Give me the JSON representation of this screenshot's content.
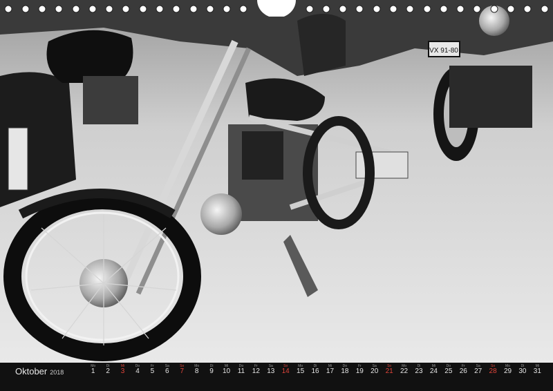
{
  "calendar": {
    "month": "Oktober",
    "year": "2018",
    "days": [
      {
        "n": "1",
        "wd": "Mo",
        "red": false
      },
      {
        "n": "2",
        "wd": "Di",
        "red": false
      },
      {
        "n": "3",
        "wd": "Mi",
        "red": true
      },
      {
        "n": "4",
        "wd": "Do",
        "red": false
      },
      {
        "n": "5",
        "wd": "Fr",
        "red": false
      },
      {
        "n": "6",
        "wd": "Sa",
        "red": false
      },
      {
        "n": "7",
        "wd": "So",
        "red": true
      },
      {
        "n": "8",
        "wd": "Mo",
        "red": false
      },
      {
        "n": "9",
        "wd": "Di",
        "red": false
      },
      {
        "n": "10",
        "wd": "Mi",
        "red": false
      },
      {
        "n": "11",
        "wd": "Do",
        "red": false
      },
      {
        "n": "12",
        "wd": "Fr",
        "red": false
      },
      {
        "n": "13",
        "wd": "Sa",
        "red": false
      },
      {
        "n": "14",
        "wd": "So",
        "red": true
      },
      {
        "n": "15",
        "wd": "Mo",
        "red": false
      },
      {
        "n": "16",
        "wd": "Di",
        "red": false
      },
      {
        "n": "17",
        "wd": "Mi",
        "red": false
      },
      {
        "n": "18",
        "wd": "Do",
        "red": false
      },
      {
        "n": "19",
        "wd": "Fr",
        "red": false
      },
      {
        "n": "20",
        "wd": "Sa",
        "red": false
      },
      {
        "n": "21",
        "wd": "So",
        "red": true
      },
      {
        "n": "22",
        "wd": "Mo",
        "red": false
      },
      {
        "n": "23",
        "wd": "Di",
        "red": false
      },
      {
        "n": "24",
        "wd": "Mi",
        "red": false
      },
      {
        "n": "25",
        "wd": "Do",
        "red": false
      },
      {
        "n": "26",
        "wd": "Fr",
        "red": false
      },
      {
        "n": "27",
        "wd": "Sa",
        "red": false
      },
      {
        "n": "28",
        "wd": "So",
        "red": true
      },
      {
        "n": "29",
        "wd": "Mo",
        "red": false
      },
      {
        "n": "30",
        "wd": "Di",
        "red": false
      },
      {
        "n": "31",
        "wd": "Mi",
        "red": false
      }
    ]
  },
  "photo": {
    "plate_text": "VX 91-80",
    "accent_red": "#e0443a"
  }
}
